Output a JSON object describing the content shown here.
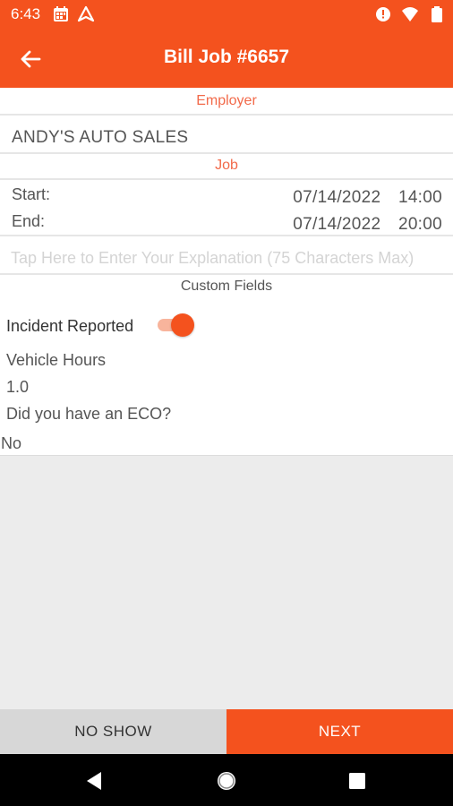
{
  "status_bar": {
    "time": "6:43",
    "left_icons": [
      "calendar-icon",
      "navigation-icon"
    ],
    "right_icons": [
      "data-saver-icon",
      "wifi-icon",
      "battery-icon"
    ]
  },
  "header": {
    "title": "Bill Job #6657",
    "back_icon": "back-arrow-icon"
  },
  "employer": {
    "label": "Employer",
    "name": "ANDY'S AUTO SALES"
  },
  "job": {
    "label": "Job",
    "start_label": "Start:",
    "start_value": "07/14/2022 14:00",
    "end_label": "End:",
    "end_value": "07/14/2022 20:00"
  },
  "explanation": {
    "placeholder": "Tap Here to Enter Your Explanation (75 Characters Max)",
    "value": ""
  },
  "custom_fields": {
    "label": "Custom Fields",
    "incident_reported": {
      "label": "Incident Reported",
      "on": true
    },
    "vehicle_hours": {
      "label": "Vehicle Hours",
      "value": "1.0"
    },
    "eco": {
      "label": "Did you have an ECO?",
      "value": "No"
    }
  },
  "buttons": {
    "no_show": "NO SHOW",
    "next": "NEXT"
  },
  "nav": [
    "back-triangle-icon",
    "home-circle-icon",
    "recents-square-icon"
  ],
  "colors": {
    "accent": "#f4521e",
    "section_label": "#f26a4a",
    "background": "#ececec"
  }
}
